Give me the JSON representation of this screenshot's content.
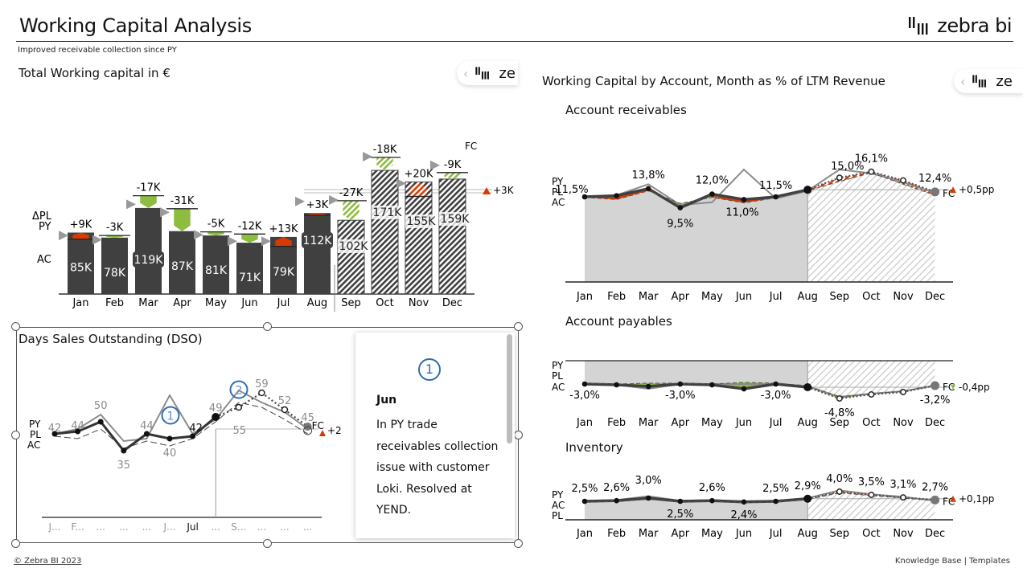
{
  "header": {
    "title": "Working Capital Analysis",
    "subtitle": "Improved receivable collection since PY",
    "logo_text": "zebra bi"
  },
  "mini_tab": {
    "chevron": "‹",
    "text": "ze"
  },
  "colors": {
    "actual": "#404040",
    "previous_year": "#8c8c8c",
    "positive": "#8cbd3f",
    "negative": "#d83b01",
    "annotation": "#2f6db5",
    "area_fill": "#d4d4d4"
  },
  "footer": {
    "copyright": "© Zebra BI 2023",
    "links": "Knowledge Base  |  Templates"
  },
  "note_card": {
    "badge": "1",
    "heading": "Jun",
    "body": "In PY trade receivables collection issue with customer Loki. Resolved at YEND."
  },
  "chart_data": [
    {
      "id": "total-working-capital",
      "type": "bar",
      "title": "Total Working capital in €",
      "categories": [
        "Jan",
        "Feb",
        "Mar",
        "Apr",
        "May",
        "Jun",
        "Jul",
        "Aug",
        "Sep",
        "Oct",
        "Nov",
        "Dec"
      ],
      "row_labels": {
        "delta_pl": "ΔPL",
        "py": "PY",
        "ac": "AC"
      },
      "scenario": [
        "AC",
        "AC",
        "AC",
        "AC",
        "AC",
        "AC",
        "AC",
        "AC",
        "FC",
        "FC",
        "FC",
        "FC"
      ],
      "values": [
        85,
        78,
        119,
        87,
        81,
        71,
        79,
        112,
        102,
        171,
        155,
        159
      ],
      "value_labels": [
        "85K",
        "78K",
        "119K",
        "87K",
        "81K",
        "71K",
        "79K",
        "112K",
        "102K",
        "171K",
        "155K",
        "159K"
      ],
      "delta_pl": [
        9,
        -3,
        -17,
        -31,
        -5,
        -12,
        13,
        3,
        -27,
        -18,
        20,
        -9
      ],
      "delta_pl_labels": [
        "+9K",
        "-3K",
        "-17K",
        "-31K",
        "-5K",
        "-12K",
        "+13K",
        "+3K",
        "-27K",
        "-18K",
        "+20K",
        "-9K"
      ],
      "py_values": [
        81,
        75,
        124,
        113,
        82,
        73,
        73,
        128,
        130,
        190,
        153,
        178
      ],
      "fc_label": "FC",
      "total_delta_label": "+3K",
      "unit": "K€"
    },
    {
      "id": "dso",
      "type": "line",
      "title": "Days Sales Outstanding (DSO)",
      "categories": [
        "J...",
        "F...",
        "...",
        "...",
        "...",
        "J...",
        "Jul",
        "...",
        "S...",
        "...",
        "...",
        "..."
      ],
      "row_labels": {
        "py": "PY",
        "pl": "PL",
        "ac": "AC"
      },
      "series": [
        {
          "name": "AC",
          "values": [
            42,
            43,
            47,
            35,
            42,
            40,
            41,
            49,
            53,
            59,
            52,
            45
          ]
        },
        {
          "name": "PY",
          "values": [
            42,
            44,
            50,
            39,
            40,
            58,
            42,
            48,
            60,
            55,
            51,
            44
          ]
        },
        {
          "name": "PL",
          "values": [
            41,
            40,
            44,
            36,
            39,
            37,
            40,
            47,
            55,
            53,
            48,
            42
          ]
        }
      ],
      "labels": [
        {
          "i": 0,
          "text": "42",
          "pos": "above"
        },
        {
          "i": 1,
          "text": "44",
          "pos": "above"
        },
        {
          "i": 2,
          "text": "50",
          "pos": "above"
        },
        {
          "i": 3,
          "text": "35",
          "pos": "below"
        },
        {
          "i": 4,
          "text": "44",
          "pos": "above"
        },
        {
          "i": 5,
          "text": "40",
          "pos": "below"
        },
        {
          "i": 6,
          "text": "42",
          "pos": "above-bold"
        },
        {
          "i": 7,
          "text": "49",
          "pos": "above"
        },
        {
          "i": 8,
          "text": "55",
          "pos": "below"
        },
        {
          "i": 9,
          "text": "59",
          "pos": "above"
        },
        {
          "i": 10,
          "text": "52",
          "pos": "above"
        },
        {
          "i": 11,
          "text": "45",
          "pos": "above"
        }
      ],
      "annotations": [
        {
          "i": 5,
          "text": "1"
        },
        {
          "i": 8,
          "text": "2"
        }
      ],
      "fc_label": "FC",
      "total_delta_label": "+2",
      "forecast_from_index": 8
    },
    {
      "id": "working-capital-by-account",
      "title": "Working Capital by Account, Month as % of LTM Revenue",
      "charts": [
        {
          "id": "account-receivables",
          "type": "area",
          "title": "Account receivables",
          "categories": [
            "Jan",
            "Feb",
            "Mar",
            "Apr",
            "May",
            "Jun",
            "Jul",
            "Aug",
            "Sep",
            "Oct",
            "Nov",
            "Dec"
          ],
          "row_labels": [
            "PY",
            "PL",
            "AC"
          ],
          "series": [
            {
              "name": "AC",
              "values": [
                11.5,
                11.7,
                13.0,
                9.5,
                12.0,
                11.0,
                11.5,
                12.8,
                15.0,
                16.1,
                14.5,
                12.4
              ]
            },
            {
              "name": "PY",
              "values": [
                11.5,
                11.8,
                13.8,
                10.0,
                10.5,
                16.5,
                11.2,
                12.6,
                16.5,
                15.8,
                14.2,
                12.2
              ]
            },
            {
              "name": "PL",
              "values": [
                11.4,
                11.0,
                12.6,
                10.3,
                11.4,
                10.4,
                11.3,
                12.6,
                14.3,
                15.9,
                13.8,
                11.8
              ]
            }
          ],
          "labels": [
            "11,5%",
            "",
            "13,8%",
            "9,5%",
            "12,0%",
            "11,0%",
            "11,5%",
            "",
            "15,0%",
            "16,1%",
            "",
            "12,4%"
          ],
          "fc_label": "FC",
          "total_delta_label": "+0,5pp",
          "forecast_from_index": 7,
          "ylim": [
            0,
            18
          ]
        },
        {
          "id": "account-payables",
          "type": "area",
          "title": "Account payables",
          "categories": [
            "Jan",
            "Feb",
            "Mar",
            "Apr",
            "May",
            "Jun",
            "Jul",
            "Aug",
            "Sep",
            "Oct",
            "Nov",
            "Dec"
          ],
          "row_labels": [
            "PY",
            "PL",
            "AC"
          ],
          "series": [
            {
              "name": "AC",
              "values": [
                -3.0,
                -3.1,
                -3.3,
                -3.0,
                -3.1,
                -3.6,
                -3.0,
                -3.4,
                -4.8,
                -4.3,
                -4.0,
                -3.2
              ]
            },
            {
              "name": "PY",
              "values": [
                -3.0,
                -3.1,
                -3.6,
                -3.0,
                -3.0,
                -3.0,
                -3.0,
                -3.3,
                -4.6,
                -4.2,
                -3.9,
                -3.2
              ]
            },
            {
              "name": "PL",
              "values": [
                -2.9,
                -3.0,
                -2.9,
                -2.9,
                -3.0,
                -2.8,
                -2.9,
                -3.2,
                -4.6,
                -4.2,
                -3.9,
                -3.1
              ]
            }
          ],
          "labels": [
            "-3,0%",
            "",
            "",
            "-3,0%",
            "",
            "",
            "-3,0%",
            "",
            "-4,8%",
            "",
            "",
            "-3,2%"
          ],
          "fc_label": "FC",
          "total_delta_label": "-0,4pp",
          "forecast_from_index": 7,
          "ylim": [
            -6,
            0
          ]
        },
        {
          "id": "inventory",
          "type": "area",
          "title": "Inventory",
          "categories": [
            "Jan",
            "Feb",
            "Mar",
            "Apr",
            "May",
            "Jun",
            "Jul",
            "Aug",
            "Sep",
            "Oct",
            "Nov",
            "Dec"
          ],
          "row_labels": [
            "PY",
            "AC",
            "PL"
          ],
          "series": [
            {
              "name": "AC",
              "values": [
                2.5,
                2.6,
                3.0,
                2.5,
                2.6,
                2.4,
                2.5,
                2.9,
                4.0,
                3.5,
                3.1,
                2.7
              ]
            },
            {
              "name": "PY",
              "values": [
                2.6,
                2.7,
                3.3,
                2.6,
                2.7,
                2.5,
                2.6,
                3.0,
                4.2,
                3.6,
                3.2,
                2.6
              ]
            },
            {
              "name": "PL",
              "values": [
                2.4,
                2.5,
                2.8,
                2.4,
                2.5,
                2.3,
                2.4,
                2.8,
                3.8,
                3.4,
                3.0,
                2.6
              ]
            }
          ],
          "labels": [
            "2,5%",
            "2,6%",
            "3,0%",
            "2,5%",
            "2,6%",
            "2,4%",
            "2,5%",
            "2,9%",
            "4,0%",
            "3,5%",
            "3,1%",
            "2,7%"
          ],
          "fc_label": "FC",
          "total_delta_label": "+0,1pp",
          "forecast_from_index": 7,
          "ylim": [
            0,
            5
          ]
        }
      ]
    }
  ]
}
